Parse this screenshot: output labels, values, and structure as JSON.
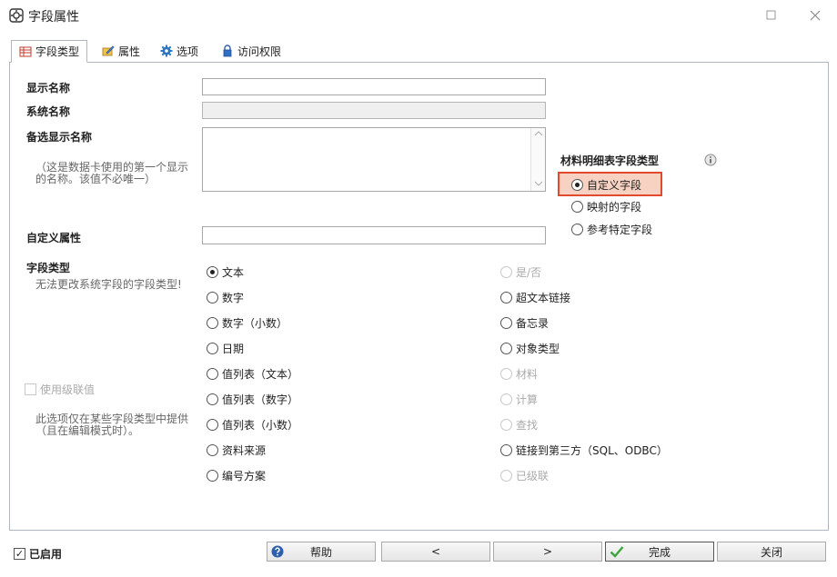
{
  "window": {
    "title": "字段属性"
  },
  "tabs": [
    {
      "label": "字段类型"
    },
    {
      "label": "属性"
    },
    {
      "label": "选项"
    },
    {
      "label": "访问权限"
    }
  ],
  "form": {
    "display_name_label": "显示名称",
    "display_name_value": "",
    "system_name_label": "系统名称",
    "system_name_value": "",
    "alt_display_name_label": "备选显示名称",
    "alt_display_name_hint": "（这是数据卡使用的第一个显示的名称。该值不必唯一）",
    "alt_display_name_value": "",
    "custom_attr_label": "自定义属性",
    "custom_attr_value": "",
    "field_type_label": "字段类型",
    "field_type_hint": "无法更改系统字段的字段类型!",
    "cascade_label": "使用级联值",
    "cascade_hint": "此选项仅在某些字段类型中提供（且在编辑模式时）。"
  },
  "field_types_left": [
    {
      "label": "文本",
      "checked": true,
      "disabled": false
    },
    {
      "label": "数字",
      "checked": false,
      "disabled": false
    },
    {
      "label": "数字（小数）",
      "checked": false,
      "disabled": false
    },
    {
      "label": "日期",
      "checked": false,
      "disabled": false
    },
    {
      "label": "值列表（文本）",
      "checked": false,
      "disabled": false
    },
    {
      "label": "值列表（数字）",
      "checked": false,
      "disabled": false
    },
    {
      "label": "值列表（小数）",
      "checked": false,
      "disabled": false
    },
    {
      "label": "资料来源",
      "checked": false,
      "disabled": false
    },
    {
      "label": "编号方案",
      "checked": false,
      "disabled": false
    }
  ],
  "field_types_right": [
    {
      "label": "是/否",
      "checked": false,
      "disabled": true
    },
    {
      "label": "超文本链接",
      "checked": false,
      "disabled": false
    },
    {
      "label": "备忘录",
      "checked": false,
      "disabled": false
    },
    {
      "label": "对象类型",
      "checked": false,
      "disabled": false
    },
    {
      "label": "材料",
      "checked": false,
      "disabled": true
    },
    {
      "label": "计算",
      "checked": false,
      "disabled": true
    },
    {
      "label": "查找",
      "checked": false,
      "disabled": true
    },
    {
      "label": "链接到第三方（SQL、ODBC）",
      "checked": false,
      "disabled": false
    },
    {
      "label": "已级联",
      "checked": false,
      "disabled": true
    }
  ],
  "bom": {
    "title": "材料明细表字段类型",
    "options": [
      {
        "label": "自定义字段",
        "checked": true
      },
      {
        "label": "映射的字段",
        "checked": false
      },
      {
        "label": "参考特定字段",
        "checked": false
      }
    ]
  },
  "footer": {
    "enabled_label": "已启用",
    "enabled_checked": true,
    "help_label": "帮助",
    "back_label": "<",
    "next_label": ">",
    "finish_label": "完成",
    "close_label": "关闭"
  },
  "colors": {
    "highlight_border": "#e24a2d",
    "highlight_fill": "#f7d2c2",
    "panel_border": "#aeb6c2"
  }
}
